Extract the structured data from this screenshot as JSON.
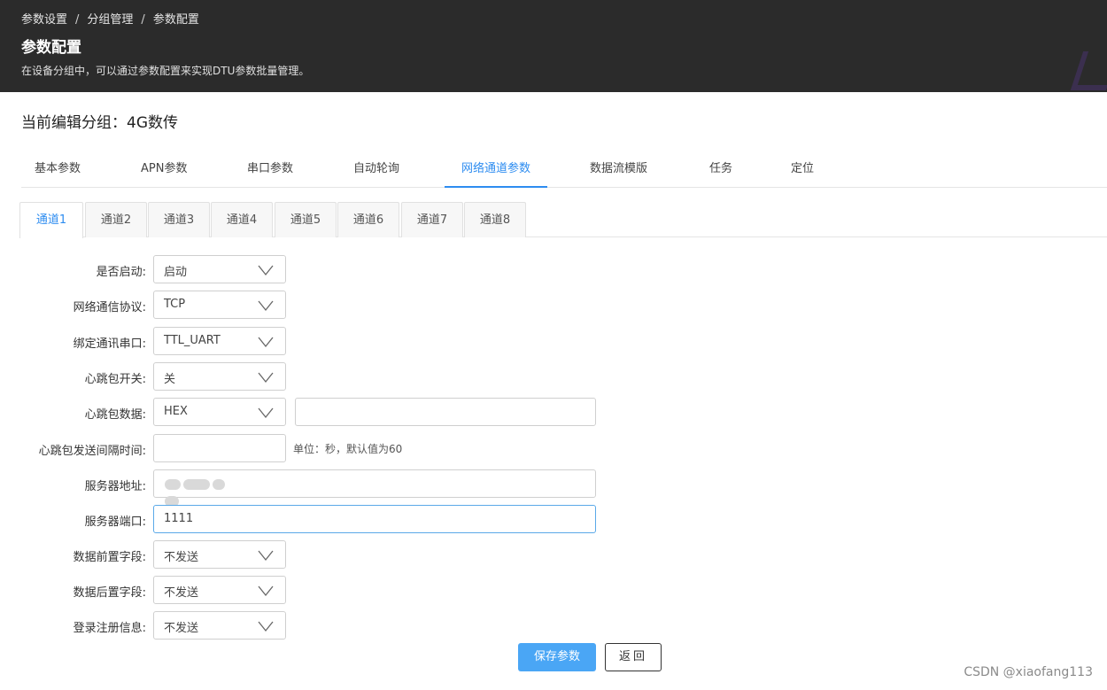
{
  "header": {
    "breadcrumb": [
      "参数设置",
      "分组管理",
      "参数配置"
    ],
    "separator": "/",
    "title": "参数配置",
    "description": "在设备分组中，可以通过参数配置来实现DTU参数批量管理。"
  },
  "group": {
    "title": "当前编辑分组：4G数传"
  },
  "main_tabs": [
    {
      "label": "基本参数"
    },
    {
      "label": "APN参数"
    },
    {
      "label": "串口参数"
    },
    {
      "label": "自动轮询"
    },
    {
      "label": "网络通道参数",
      "active": true
    },
    {
      "label": "数据流模版"
    },
    {
      "label": "任务"
    },
    {
      "label": "定位"
    }
  ],
  "channel_tabs": [
    {
      "label": "通道1",
      "active": true
    },
    {
      "label": "通道2"
    },
    {
      "label": "通道3"
    },
    {
      "label": "通道4"
    },
    {
      "label": "通道5"
    },
    {
      "label": "通道6"
    },
    {
      "label": "通道7"
    },
    {
      "label": "通道8"
    }
  ],
  "form": {
    "enable": {
      "label": "是否启动:",
      "value": "启动"
    },
    "protocol": {
      "label": "网络通信协议:",
      "value": "TCP"
    },
    "serial": {
      "label": "绑定通讯串口:",
      "value": "TTL_UART"
    },
    "heartbeat_switch": {
      "label": "心跳包开关:",
      "value": "关"
    },
    "heartbeat_data": {
      "label": "心跳包数据:",
      "format": "HEX",
      "value": ""
    },
    "heartbeat_interval": {
      "label": "心跳包发送间隔时间:",
      "value": "",
      "hint": "单位：秒，默认值为60"
    },
    "server_address": {
      "label": "服务器地址:"
    },
    "server_port": {
      "label": "服务器端口:",
      "value": "1111"
    },
    "prefix": {
      "label": "数据前置字段:",
      "value": "不发送"
    },
    "suffix": {
      "label": "数据后置字段:",
      "value": "不发送"
    },
    "login": {
      "label": "登录注册信息:",
      "value": "不发送"
    }
  },
  "buttons": {
    "save": "保存参数",
    "back": "返回"
  },
  "watermark": "CSDN @xiaofang113",
  "colors": {
    "header_bg": "#2b2b2b",
    "accent": "#2d8cf0",
    "save_button": "#4aa6f5"
  }
}
